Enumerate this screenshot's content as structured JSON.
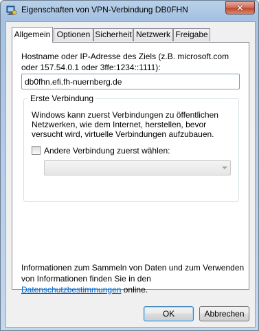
{
  "window": {
    "title": "Eigenschaften von VPN-Verbindung DB0FHN",
    "close_glyph": "✕"
  },
  "tabs": [
    {
      "label": "Allgemein",
      "active": true
    },
    {
      "label": "Optionen",
      "active": false
    },
    {
      "label": "Sicherheit",
      "active": false
    },
    {
      "label": "Netzwerk",
      "active": false
    },
    {
      "label": "Freigabe",
      "active": false
    }
  ],
  "general": {
    "host_label": "Hostname oder IP-Adresse des Ziels (z.B. microsoft.com oder 157.54.0.1 oder 3ffe:1234::1111):",
    "host_value": "db0fhn.efi.fh-nuernberg.de",
    "first_connection": {
      "title": "Erste Verbindung",
      "description": "Windows kann zuerst Verbindungen zu öffentlichen Netzwerken, wie dem Internet, herstellen, bevor versucht wird, virtuelle Verbindungen aufzubauen.",
      "checkbox_label": "Andere Verbindung zuerst wählen:",
      "checkbox_checked": false,
      "dropdown_value": ""
    },
    "info": {
      "text_before": "Informationen zum Sammeln von Daten und zum Verwenden von Informationen finden Sie in den ",
      "link": "Datenschutzbestimmungen",
      "text_after": " online."
    }
  },
  "buttons": {
    "ok": "OK",
    "cancel": "Abbrechen"
  },
  "icons": {
    "window_icon": "vpn-connection-icon",
    "close": "close-icon",
    "dropdown": "chevron-down-icon"
  },
  "colors": {
    "link": "#0066cc",
    "close_button": "#c04a32",
    "title_bar": "#b9d1ea"
  }
}
